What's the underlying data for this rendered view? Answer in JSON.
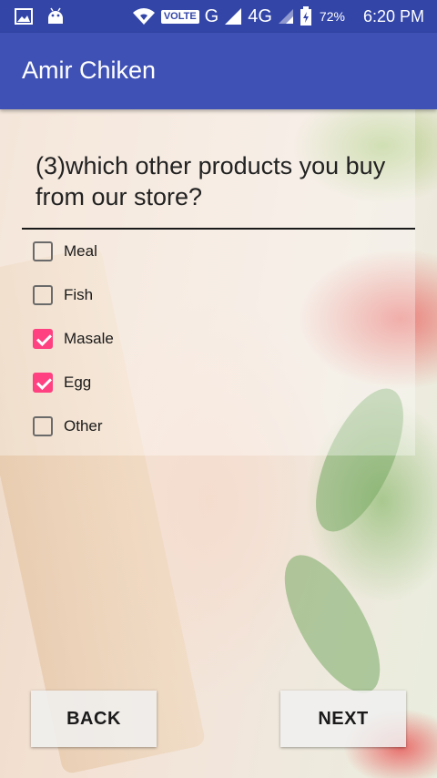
{
  "status_bar": {
    "volte_label": "VOLTE",
    "network_g": "G",
    "network_4g": "4G",
    "battery_percent": "72%",
    "time": "6:20 PM",
    "icons": [
      "image-icon",
      "android-icon",
      "wifi-icon",
      "signal-icon",
      "battery-icon"
    ]
  },
  "app_bar": {
    "title": "Amir Chiken",
    "color": "#3f51b5"
  },
  "question": {
    "text": "(3)which other products you buy from our store?"
  },
  "options": [
    {
      "label": "Meal",
      "checked": false
    },
    {
      "label": "Fish",
      "checked": false
    },
    {
      "label": "Masale",
      "checked": true
    },
    {
      "label": "Egg",
      "checked": true
    },
    {
      "label": "Other",
      "checked": false
    }
  ],
  "buttons": {
    "back_label": "BACK",
    "next_label": "NEXT"
  },
  "colors": {
    "status_bar": "#3346a8",
    "checkbox_accent": "#ff4081"
  }
}
